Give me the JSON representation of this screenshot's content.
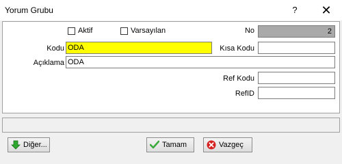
{
  "window": {
    "title": "Yorum Grubu",
    "help_glyph": "?",
    "close_glyph": "✕"
  },
  "form": {
    "aktif_label": "Aktif",
    "varsayilan_label": "Varsayılan",
    "no_label": "No",
    "no_value": "2",
    "kodu_label": "Kodu",
    "kodu_value": "ODA",
    "kisa_kodu_label": "Kısa Kodu",
    "kisa_kodu_value": "",
    "aciklama_label": "Açıklama",
    "aciklama_value": "ODA",
    "ref_kodu_label": "Ref Kodu",
    "ref_kodu_value": "",
    "refid_label": "RefID",
    "refid_value": ""
  },
  "buttons": {
    "diger": "Diğer...",
    "tamam": "Tamam",
    "vazgec": "Vazgeç"
  },
  "colors": {
    "kodu_bg": "#ffff00",
    "no_bg": "#a9a9a9"
  }
}
